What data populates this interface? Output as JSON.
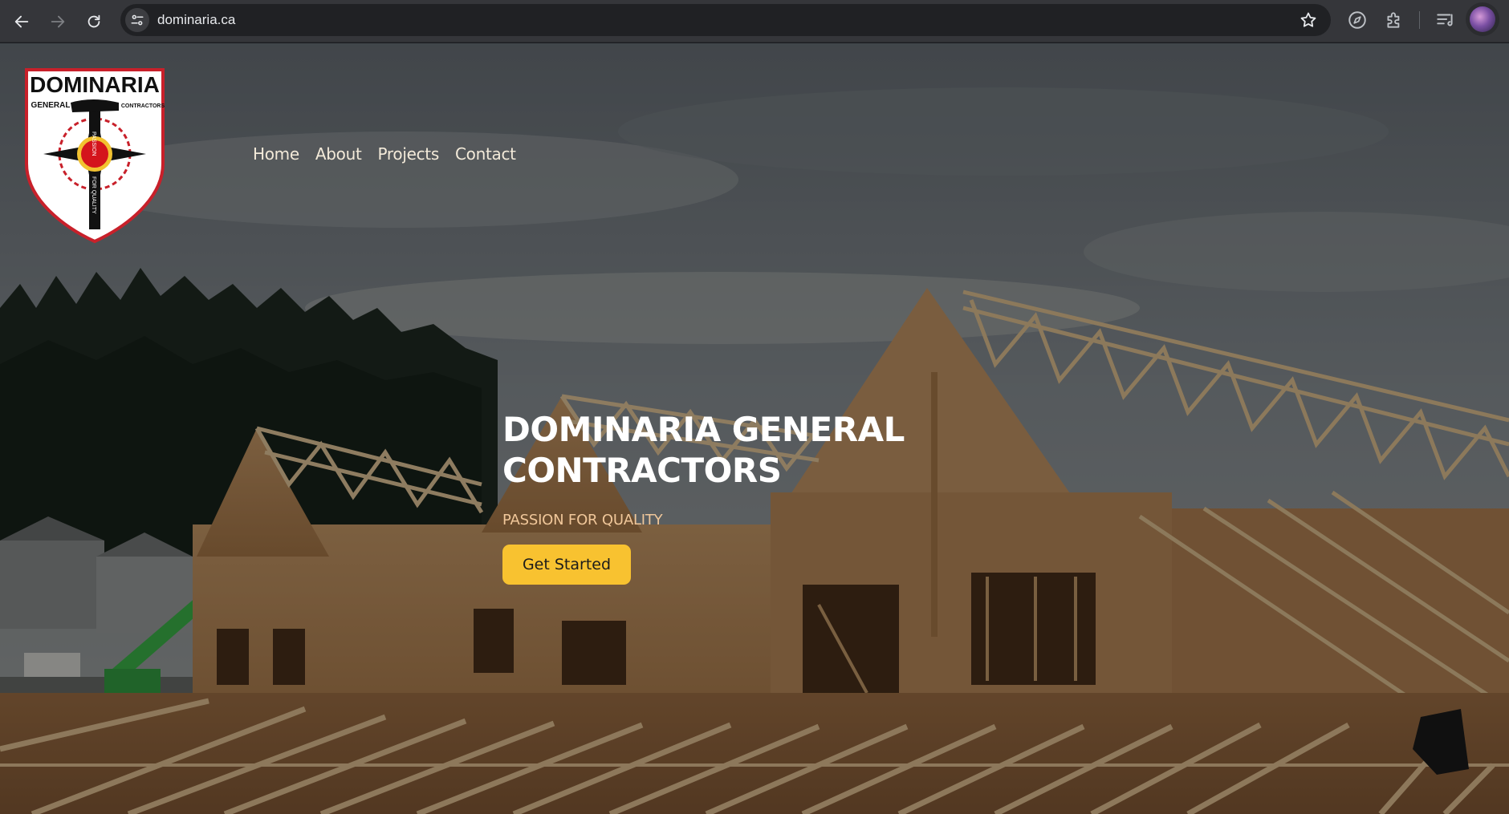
{
  "browser": {
    "url": "dominaria.ca",
    "back_icon": "arrow-left-icon",
    "forward_icon": "arrow-right-icon",
    "reload_icon": "reload-icon",
    "site_info_icon": "tune-icon",
    "bookmark_icon": "star-icon",
    "tools": [
      "compass-icon",
      "extensions-icon",
      "reading-list-icon"
    ],
    "profile_icon": "avatar"
  },
  "site": {
    "logo": {
      "name": "DOMINARIA",
      "left_word": "GENERAL",
      "right_word": "CONTRACTORS",
      "handle_top": "PASSION",
      "handle_bottom": "FOR QUALITY"
    },
    "nav": [
      {
        "label": "Home"
      },
      {
        "label": "About"
      },
      {
        "label": "Projects"
      },
      {
        "label": "Contact"
      }
    ],
    "hero": {
      "title_line1": "DOMINARIA GENERAL",
      "title_line2": "CONTRACTORS",
      "tagline": "PASSION FOR QUALITY",
      "cta_label": "Get Started"
    }
  },
  "colors": {
    "accent": "#f8c230",
    "tagline": "#f0c79a",
    "chrome": "#35363a",
    "logo_red": "#c8202a"
  }
}
